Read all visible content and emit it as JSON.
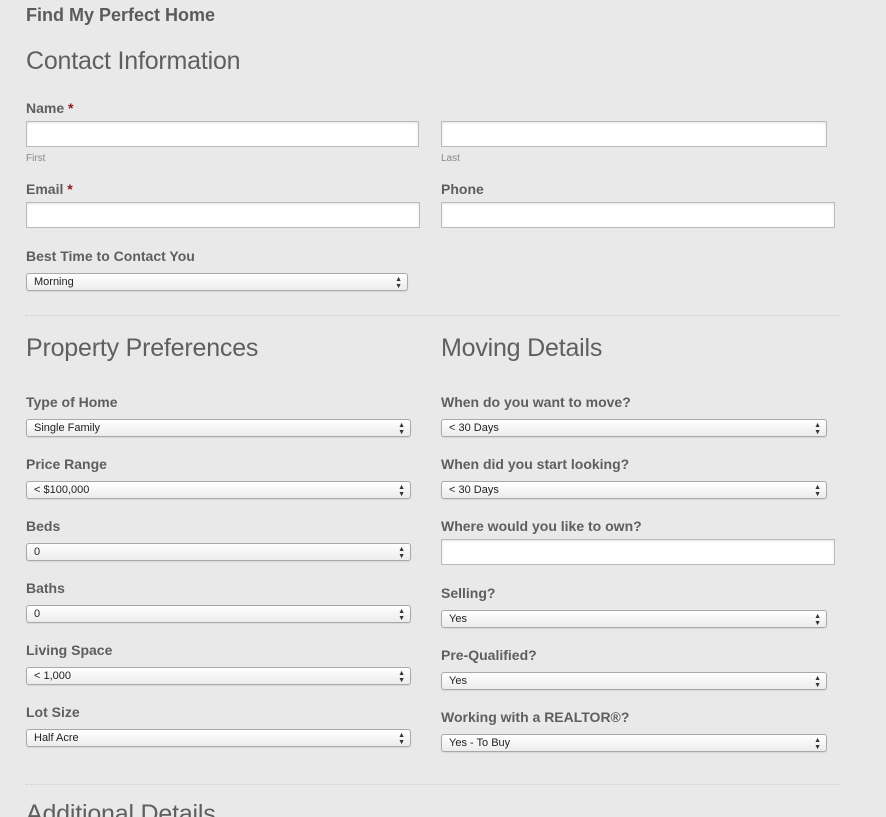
{
  "form_title": "Find My Perfect Home",
  "contact": {
    "heading": "Contact Information",
    "name_label": "Name",
    "required_mark": "*",
    "first_sublabel": "First",
    "last_sublabel": "Last",
    "email_label": "Email",
    "phone_label": "Phone",
    "best_time_label": "Best Time to Contact You",
    "best_time_value": "Morning"
  },
  "property": {
    "heading": "Property Preferences",
    "type_label": "Type of Home",
    "type_value": "Single Family",
    "price_label": "Price Range",
    "price_value": "< $100,000",
    "beds_label": "Beds",
    "beds_value": "0",
    "baths_label": "Baths",
    "baths_value": "0",
    "living_label": "Living Space",
    "living_value": "< 1,000",
    "lot_label": "Lot Size",
    "lot_value": "Half Acre"
  },
  "moving": {
    "heading": "Moving Details",
    "when_move_label": "When do you want to move?",
    "when_move_value": "< 30 Days",
    "start_label": "When did you start looking?",
    "start_value": "< 30 Days",
    "where_label": "Where would you like to own?",
    "selling_label": "Selling?",
    "selling_value": "Yes",
    "prequal_label": "Pre-Qualified?",
    "prequal_value": "Yes",
    "realtor_label": "Working with a REALTOR®?",
    "realtor_value": "Yes - To Buy"
  },
  "additional": {
    "heading": "Additional Details"
  },
  "icons": {
    "select_arrows": "▲▼"
  }
}
